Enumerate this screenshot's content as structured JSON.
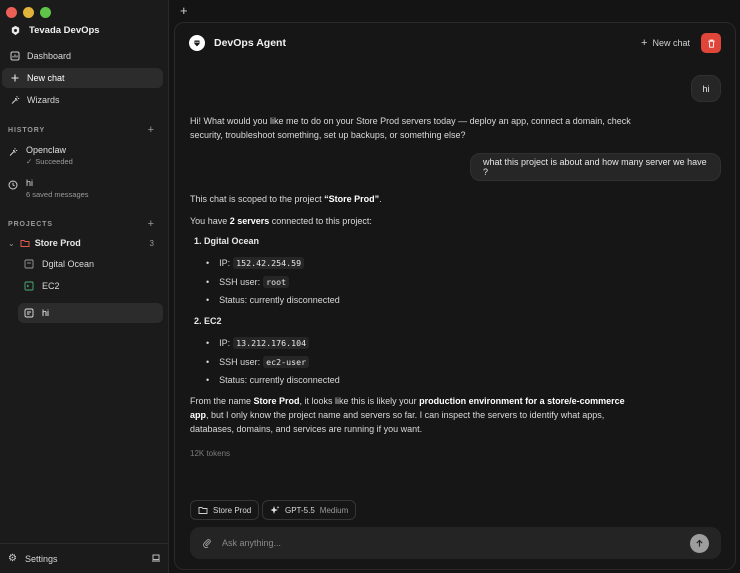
{
  "sidebar": {
    "brand": "Tevada DevOps",
    "nav": {
      "dashboard": "Dashboard",
      "new_chat": "New chat",
      "wizards": "Wizards"
    },
    "history_title": "HISTORY",
    "history": [
      {
        "title": "Openclaw",
        "sub": "Succeeded"
      },
      {
        "title": "hi",
        "sub": "6 saved messages"
      }
    ],
    "projects_title": "PROJECTS",
    "project": {
      "name": "Store Prod",
      "count": "3"
    },
    "servers": [
      "Dgital Ocean",
      "EC2",
      "hi"
    ],
    "settings": "Settings"
  },
  "header": {
    "agent_name": "DevOps Agent",
    "new_chat": "New chat"
  },
  "chat": {
    "user1": "hi",
    "reply1": "Hi! What would you like me to do on your Store Prod servers today — deploy an app, connect a domain, check security, troubleshoot something, set up backups, or something else?",
    "user2": "what this project is about and how many server we have ?",
    "scope_pre": "This chat is scoped to the project ",
    "scope_project": "“Store Prod”",
    "scope_post": ".",
    "count_pre": "You have ",
    "count_bold": "2 servers",
    "count_post": " connected to this project:",
    "servers": [
      {
        "name": "1. Dgital Ocean",
        "ip_label": "IP:",
        "ip": "152.42.254.59",
        "user_label": "SSH user:",
        "user": "root",
        "status": "Status: currently disconnected"
      },
      {
        "name": "2. EC2",
        "ip_label": "IP:",
        "ip": "13.212.176.104",
        "user_label": "SSH user:",
        "user": "ec2-user",
        "status": "Status: currently disconnected"
      }
    ],
    "summary_1": "From the name ",
    "summary_2": "Store Prod",
    "summary_3": ", it looks like this is likely your ",
    "summary_4": "production environment for a store/e-commerce app",
    "summary_5": ", but I only know the project name and servers so far. I can inspect the servers to identify what apps, databases, domains, and services are running if you want.",
    "tokens": "12K tokens"
  },
  "composer": {
    "project_chip": "Store Prod",
    "model": "GPT-5.5",
    "effort": "Medium",
    "placeholder": "Ask anything..."
  },
  "colors": {
    "accent_red": "#e0453a",
    "folder_red": "#e25a4a"
  }
}
